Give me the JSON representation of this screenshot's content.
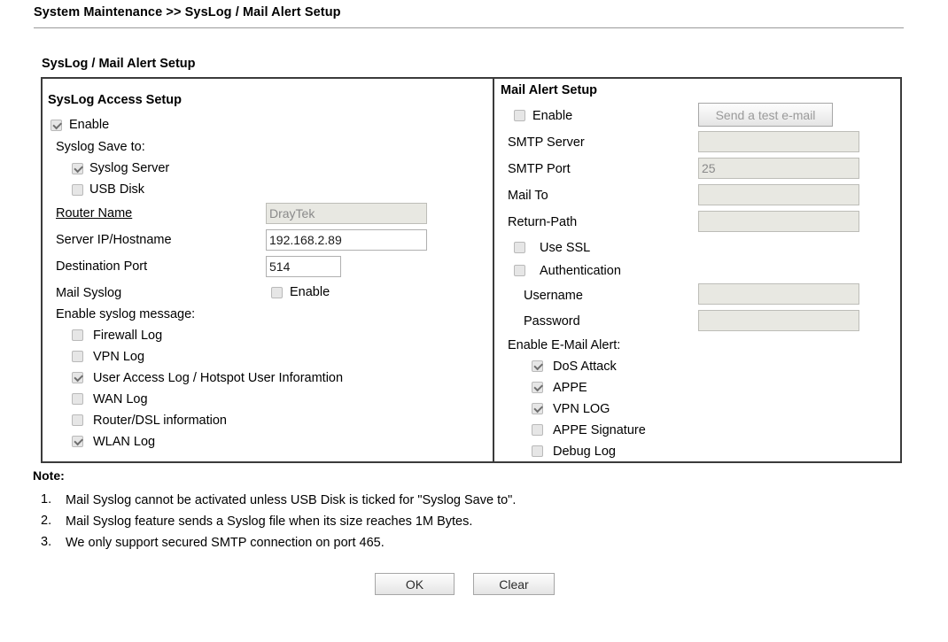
{
  "breadcrumb": "System Maintenance >> SysLog / Mail Alert Setup",
  "section_title": "SysLog / Mail Alert Setup",
  "syslog": {
    "heading": "SysLog Access Setup",
    "enable_label": "Enable",
    "enable_checked": true,
    "save_to_label": "Syslog Save to:",
    "save_to": [
      {
        "label": "Syslog Server",
        "checked": true
      },
      {
        "label": "USB Disk",
        "checked": false
      }
    ],
    "router_name_label": "Router Name",
    "router_name_value": "DrayTek",
    "server_ip_label": "Server IP/Hostname",
    "server_ip_value": "192.168.2.89",
    "dest_port_label": "Destination Port",
    "dest_port_value": "514",
    "mail_syslog_label": "Mail Syslog",
    "mail_syslog_enable_label": "Enable",
    "mail_syslog_checked": false,
    "enable_msg_label": "Enable syslog message:",
    "messages": [
      {
        "label": "Firewall Log",
        "checked": false
      },
      {
        "label": "VPN Log",
        "checked": false
      },
      {
        "label": "User Access Log / Hotspot User Inforamtion",
        "checked": true
      },
      {
        "label": "WAN Log",
        "checked": false
      },
      {
        "label": "Router/DSL information",
        "checked": false
      },
      {
        "label": "WLAN Log",
        "checked": true
      }
    ]
  },
  "mail": {
    "heading": "Mail Alert Setup",
    "enable_label": "Enable",
    "enable_checked": false,
    "send_test_label": "Send a test e-mail",
    "smtp_server_label": "SMTP Server",
    "smtp_server_value": "",
    "smtp_port_label": "SMTP Port",
    "smtp_port_value": "25",
    "mail_to_label": "Mail To",
    "mail_to_value": "",
    "return_path_label": "Return-Path",
    "return_path_value": "",
    "use_ssl_label": "Use SSL",
    "use_ssl_checked": false,
    "auth_label": "Authentication",
    "auth_checked": false,
    "username_label": "Username",
    "username_value": "",
    "password_label": "Password",
    "password_value": "",
    "enable_alert_label": "Enable E-Mail Alert:",
    "alerts": [
      {
        "label": "DoS Attack",
        "checked": true
      },
      {
        "label": "APPE",
        "checked": true
      },
      {
        "label": "VPN LOG",
        "checked": true
      },
      {
        "label": "APPE Signature",
        "checked": false
      },
      {
        "label": "Debug Log",
        "checked": false
      }
    ]
  },
  "notes": {
    "heading": "Note:",
    "items": [
      {
        "num": "1.",
        "text": "Mail Syslog cannot be activated unless USB Disk is ticked for \"Syslog Save to\"."
      },
      {
        "num": "2.",
        "text": "Mail Syslog feature sends a Syslog file when its size reaches 1M Bytes."
      },
      {
        "num": "3.",
        "text": "We only support secured SMTP connection on port 465."
      }
    ]
  },
  "actions": {
    "ok_label": "OK",
    "clear_label": "Clear"
  }
}
